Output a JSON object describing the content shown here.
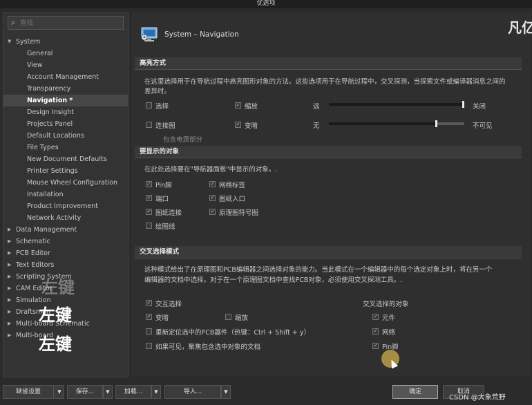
{
  "window": {
    "title": "优选项"
  },
  "search": {
    "icon": "search-icon",
    "placeholder": "查找"
  },
  "tree": [
    {
      "label": "System",
      "level": "top",
      "expanded": true
    },
    {
      "label": "General",
      "level": "child"
    },
    {
      "label": "View",
      "level": "child"
    },
    {
      "label": "Account Management",
      "level": "child"
    },
    {
      "label": "Transparency",
      "level": "child"
    },
    {
      "label": "Navigation *",
      "level": "child",
      "selected": true
    },
    {
      "label": "Design Insight",
      "level": "child"
    },
    {
      "label": "Projects Panel",
      "level": "child"
    },
    {
      "label": "Default Locations",
      "level": "child"
    },
    {
      "label": "File Types",
      "level": "child"
    },
    {
      "label": "New Document Defaults",
      "level": "child"
    },
    {
      "label": "Printer Settings",
      "level": "child"
    },
    {
      "label": "Mouse Wheel Configuration",
      "level": "child"
    },
    {
      "label": "Installation",
      "level": "child"
    },
    {
      "label": "Product Improvement",
      "level": "child"
    },
    {
      "label": "Network Activity",
      "level": "child"
    },
    {
      "label": "Data Management",
      "level": "top"
    },
    {
      "label": "Schematic",
      "level": "top"
    },
    {
      "label": "PCB Editor",
      "level": "top"
    },
    {
      "label": "Text Editors",
      "level": "top"
    },
    {
      "label": "Scripting System",
      "level": "top"
    },
    {
      "label": "CAM Editor",
      "level": "top"
    },
    {
      "label": "Simulation",
      "level": "top"
    },
    {
      "label": "Draftsman",
      "level": "top"
    },
    {
      "label": "Multi-board Schematic",
      "level": "top"
    },
    {
      "label": "Multi-board",
      "level": "top"
    }
  ],
  "header": {
    "title": "System – Navigation",
    "icon": "navigation-monitor-icon",
    "brand": "凡亿"
  },
  "highlight": {
    "title": "高亮方式",
    "desc1": "在这里选择用于在导航过程中高亮图形对象的方法。这些选项用于在导航过程中，交叉探测，当探索文件或编译器消息之间的",
    "desc2": "差异时。",
    "select": {
      "label": "选择",
      "checked": false
    },
    "zoom": {
      "label": "缩放",
      "checked": true
    },
    "mask": {
      "label": "连接图",
      "checked": false
    },
    "dim": {
      "label": "变暗",
      "checked": true
    },
    "slider1": {
      "left": "远",
      "right": "关闭",
      "value": 1.0
    },
    "slider2": {
      "left": "无",
      "right": "不可见",
      "value": 0.8
    },
    "include_power": "包含电源部分"
  },
  "objects": {
    "title": "要显示的对象",
    "desc": "在此处选择要在\"导航器面板\"中显示的对象。.",
    "items": [
      {
        "label": "Pin脚",
        "checked": true
      },
      {
        "label": "网络标签",
        "checked": true
      },
      {
        "label": "端口",
        "checked": true
      },
      {
        "label": "图纸入口",
        "checked": true
      },
      {
        "label": "图纸连接",
        "checked": true
      },
      {
        "label": "原理图符号图",
        "checked": true
      },
      {
        "label": "绘图线",
        "checked": false
      }
    ]
  },
  "cross": {
    "title": "交叉选择模式",
    "desc1": "这种模式给出了在原理图和PCB编辑器之间选择对象的能力。当此模式在一个编辑器中的每个选定对象上时，将在另一个",
    "desc2": "编辑器的文档中选择。对于在一个原理图文档中查找PCB对象，必须使用交叉探测工具。.",
    "interactive": {
      "label": "交互选择",
      "checked": true
    },
    "dim": {
      "label": "变暗",
      "checked": true
    },
    "zoom": {
      "label": "缩放",
      "checked": false
    },
    "relocate": {
      "label": "重新定位选中的PCB器件（热键：Ctrl + Shift + y）",
      "checked": false
    },
    "open_docs": {
      "label": "如果可见，聚焦包含选中对象的文档",
      "checked": false
    },
    "objects_title": "交叉选择的对象",
    "obj1": {
      "label": "元件",
      "checked": true
    },
    "obj2": {
      "label": "网络",
      "checked": true
    },
    "obj3": {
      "label": "Pin脚",
      "checked": true
    }
  },
  "footer": {
    "defaults": "缺省设置",
    "save": "保存...",
    "load": "加载...",
    "import": "导入...",
    "ok": "确定",
    "cancel": "取消"
  },
  "overlays": {
    "text1": "左键",
    "text2": "左键",
    "text3": "左键",
    "watermark": "CSDN @大象荒野"
  }
}
